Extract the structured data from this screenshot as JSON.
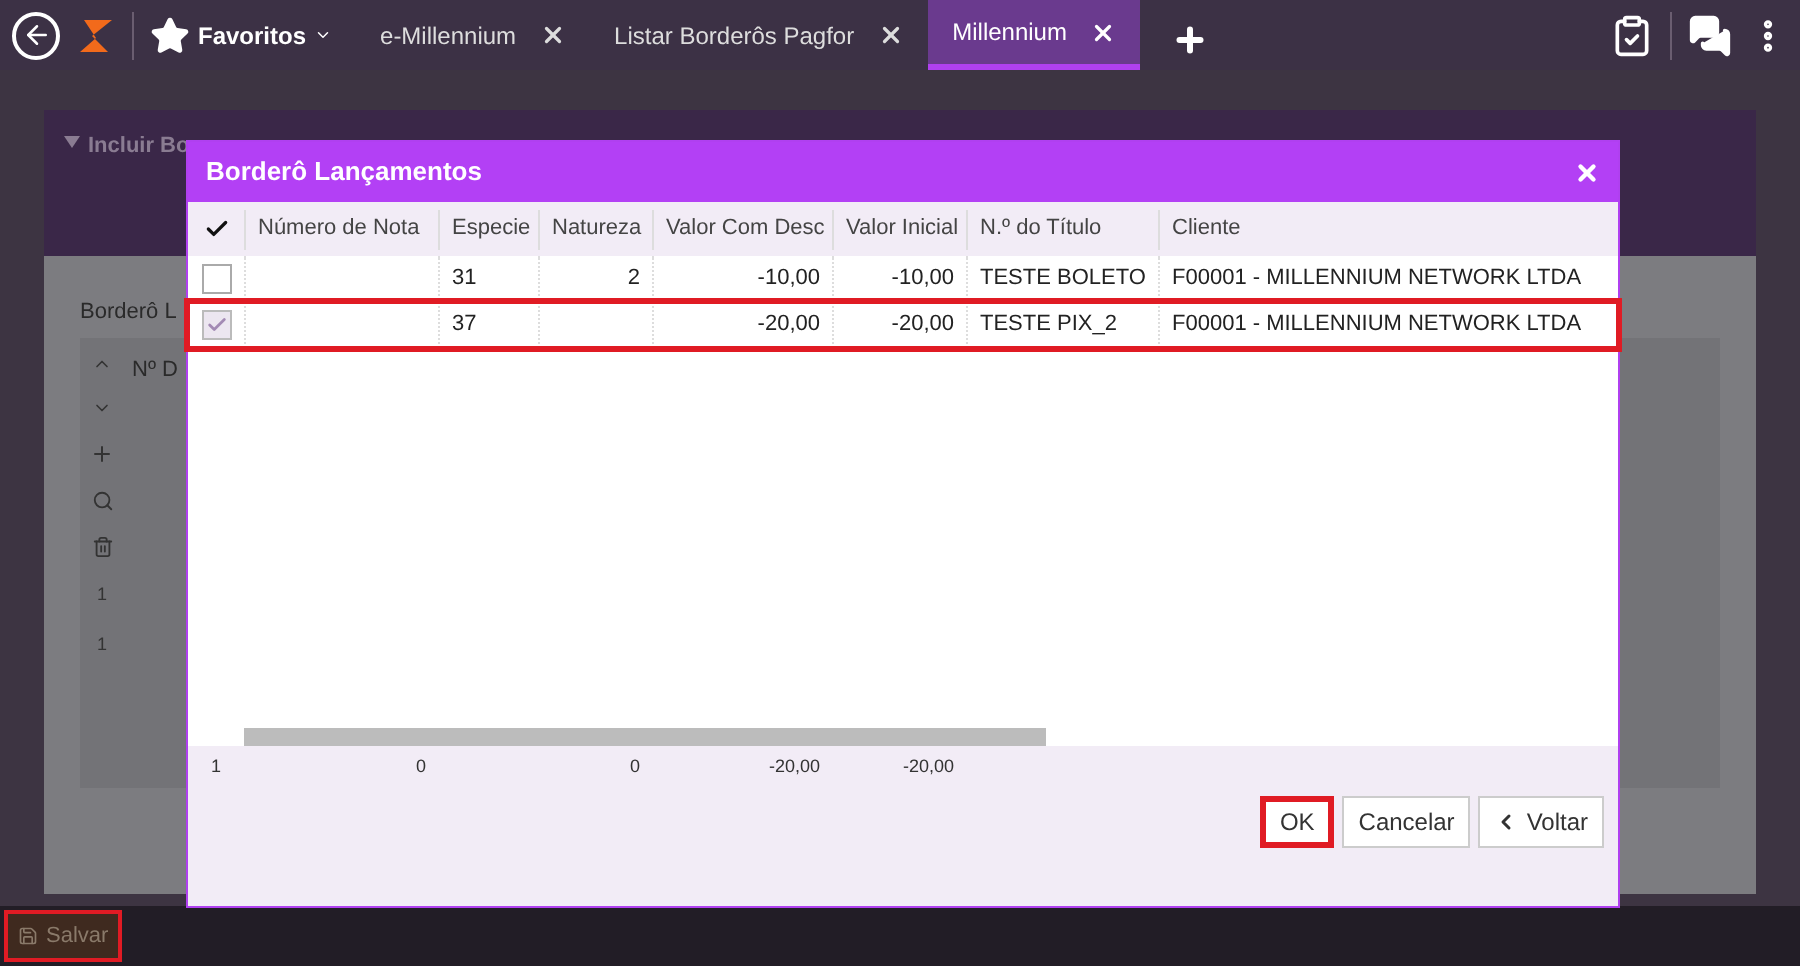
{
  "top_bar": {
    "favorites": "Favoritos",
    "tabs": [
      {
        "label": "e-Millennium",
        "selected": false
      },
      {
        "label": "Listar Borderôs Pagfor",
        "selected": false
      },
      {
        "label": "Millennium",
        "selected": true
      }
    ]
  },
  "background_page": {
    "panel_title": "Incluir Bo",
    "section_label": "Borderô L",
    "column_header": "Nº D",
    "row_numbers": [
      "1",
      "1"
    ]
  },
  "dialog": {
    "title": "Borderô Lançamentos",
    "columns": [
      "Número de Nota",
      "Especie",
      "Natureza",
      "Valor Com Desc",
      "Valor Inicial",
      "N.º do Título",
      "Cliente"
    ],
    "rows": [
      {
        "checked": false,
        "highlighted": false,
        "cells": [
          "",
          "31",
          "2",
          "-10,00",
          "-10,00",
          "TESTE BOLETO",
          "F00001 - MILLENNIUM NETWORK LTDA"
        ]
      },
      {
        "checked": true,
        "highlighted": true,
        "cells": [
          "",
          "37",
          "",
          "-20,00",
          "-20,00",
          "TESTE PIX_2",
          "F00001 - MILLENNIUM NETWORK LTDA"
        ]
      }
    ],
    "totals": [
      "1",
      "0",
      "0",
      "-20,00",
      "-20,00"
    ],
    "buttons": [
      {
        "label": "OK",
        "kind": "ok",
        "highlighted": true
      },
      {
        "label": "Cancelar",
        "kind": "cancel",
        "highlighted": false
      },
      {
        "label": "Voltar",
        "kind": "back",
        "highlighted": false
      }
    ]
  },
  "bottom_bar": {
    "save": {
      "label": "Salvar",
      "highlighted": true
    }
  }
}
